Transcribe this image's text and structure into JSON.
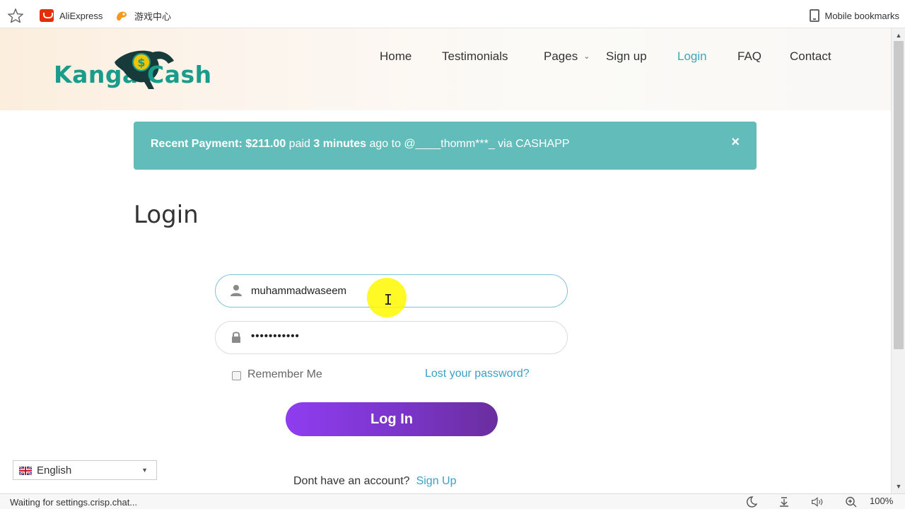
{
  "browser": {
    "bookmarks": [
      {
        "label": "AliExpress",
        "icon": "aliexpress-icon"
      },
      {
        "label": "游戏中心",
        "icon": "game-center-icon"
      }
    ],
    "mobile_bookmarks": "Mobile bookmarks",
    "status_text": "Waiting for settings.crisp.chat...",
    "zoom": "100%"
  },
  "site": {
    "logo_left": "Kanga",
    "logo_right": "Cash",
    "nav": [
      {
        "label": "Home"
      },
      {
        "label": "Testimonials"
      },
      {
        "label": "Pages"
      },
      {
        "label": "Sign up"
      },
      {
        "label": "Login"
      },
      {
        "label": "FAQ"
      },
      {
        "label": "Contact"
      }
    ],
    "active_nav": "Login"
  },
  "alert": {
    "prefix": "Recent Payment: $211.00",
    "paid": " paid ",
    "time": "3 minutes",
    "rest": " ago to @____thomm***_ via CASHAPP",
    "close": "×"
  },
  "login": {
    "title": "Login",
    "username": "muhammadwaseem",
    "password_masked": "•••••••••••",
    "remember_label": "Remember Me",
    "lost_password": "Lost your password?",
    "button": "Log In",
    "no_account": "Dont have an account?",
    "signup": "Sign Up"
  },
  "language": {
    "selected": "English"
  },
  "colors": {
    "accent_teal": "#62bcba",
    "brand_green": "#1a9c8c",
    "link_blue": "#3aa0c8",
    "button_purple": "#8f3df0"
  }
}
